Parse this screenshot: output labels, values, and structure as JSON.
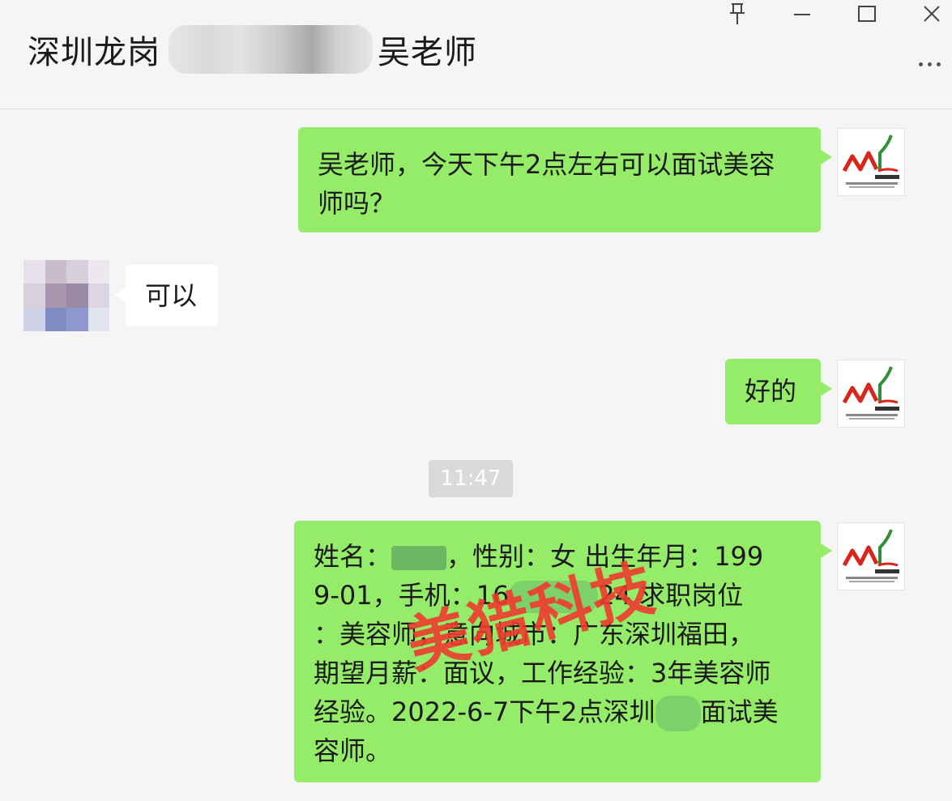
{
  "window": {
    "title_prefix": "深圳龙岗",
    "title_suffix": "吴老师"
  },
  "messages": {
    "m1": {
      "line1": "吴老师，今天下午2点左右可以面试美容",
      "line2": "师吗？"
    },
    "m2": {
      "text": "可以"
    },
    "m3": {
      "text": "好的"
    },
    "timestamp": "11:47",
    "m4": {
      "l1a": "姓名：",
      "l1b": "，性别：女    出生年月：199",
      "l2a": "9-01，手机：16",
      "l2b": "24  求职岗位",
      "l3": "：美容师，意向城市：广东深圳福田，",
      "l4": "期望月薪：面议，工作经验：3年美容师",
      "l5a": "经验。2022-6-7下午2点深圳",
      "l5b": "面试美",
      "l6": "容师。"
    }
  },
  "watermark": {
    "text": "美猎科技"
  },
  "icons": {
    "pin": "pin-icon",
    "minimize": "minimize-icon",
    "maximize": "maximize-icon",
    "close": "close-icon",
    "more": "more-icon"
  },
  "colors": {
    "my_bubble": "#95ec69",
    "their_bubble": "#ffffff",
    "background": "#f5f5f5",
    "watermark": "#ee3b2e"
  }
}
